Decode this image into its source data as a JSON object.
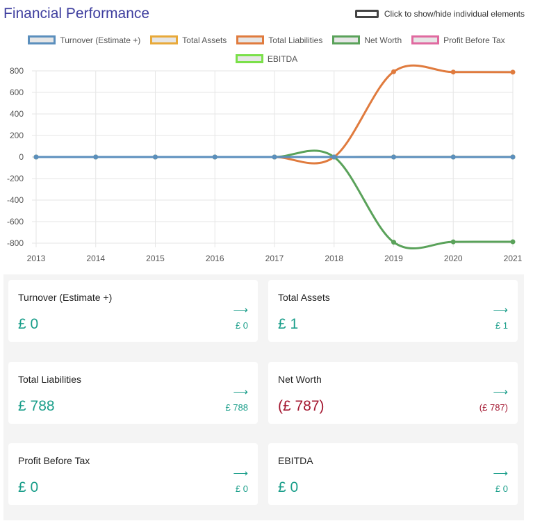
{
  "header": {
    "title": "Financial Performance",
    "toggle_label": "Click to show/hide individual elements"
  },
  "legend": [
    {
      "name": "Turnover (Estimate +)",
      "color": "#5b8fbd"
    },
    {
      "name": "Total Assets",
      "color": "#e8a93a"
    },
    {
      "name": "Total Liabilities",
      "color": "#e07b3e"
    },
    {
      "name": "Net Worth",
      "color": "#5aa25a"
    },
    {
      "name": "Profit Before Tax",
      "color": "#e06aa0"
    },
    {
      "name": "EBITDA",
      "color": "#7be04a"
    }
  ],
  "chart_data": {
    "type": "line",
    "x": [
      "2013",
      "2014",
      "2015",
      "2016",
      "2017",
      "2018",
      "2019",
      "2020",
      "2021"
    ],
    "y_ticks": [
      800,
      600,
      400,
      200,
      0,
      -200,
      -400,
      -600,
      -800
    ],
    "ylim": [
      -800,
      800
    ],
    "grid": true,
    "series": [
      {
        "name": "Total Liabilities",
        "color": "#e07b3e",
        "values": [
          0,
          0,
          0,
          0,
          0,
          0,
          792,
          789,
          788
        ]
      },
      {
        "name": "Net Worth",
        "color": "#5aa25a",
        "values": [
          0,
          0,
          0,
          0,
          0,
          0,
          -791,
          -788,
          -787
        ]
      },
      {
        "name": "Total Assets",
        "color": "#e8a93a",
        "values": [
          0,
          0,
          0,
          0,
          0,
          0,
          1,
          1,
          1
        ]
      },
      {
        "name": "Profit Before Tax",
        "color": "#e06aa0",
        "values": [
          0,
          0,
          0,
          0,
          0,
          0,
          0,
          0,
          0
        ]
      },
      {
        "name": "EBITDA",
        "color": "#7be04a",
        "values": [
          0,
          0,
          0,
          0,
          0,
          0,
          0,
          0,
          0
        ]
      },
      {
        "name": "Turnover (Estimate +)",
        "color": "#5b8fbd",
        "values": [
          0,
          0,
          0,
          0,
          0,
          0,
          0,
          0,
          0
        ]
      }
    ]
  },
  "cards": [
    {
      "label": "Turnover (Estimate +)",
      "value": "£ 0",
      "arrow": "⟶",
      "small": "£ 0",
      "tone": "pos"
    },
    {
      "label": "Total Assets",
      "value": "£ 1",
      "arrow": "⟶",
      "small": "£ 1",
      "tone": "pos"
    },
    {
      "label": "Total Liabilities",
      "value": "£ 788",
      "arrow": "⟶",
      "small": "£ 788",
      "tone": "pos"
    },
    {
      "label": "Net Worth",
      "value": "(£ 787)",
      "arrow": "⟶",
      "small": "(£ 787)",
      "tone": "neg"
    },
    {
      "label": "Profit Before Tax",
      "value": "£ 0",
      "arrow": "⟶",
      "small": "£ 0",
      "tone": "pos"
    },
    {
      "label": "EBITDA",
      "value": "£ 0",
      "arrow": "⟶",
      "small": "£ 0",
      "tone": "pos"
    }
  ]
}
